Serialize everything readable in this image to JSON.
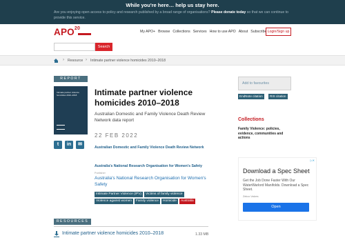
{
  "banner": {
    "title": "While you're here… help us stay here.",
    "text": "Are you enjoying open access to policy and research published by a broad range of organisations?",
    "donate": "Please donate today",
    "text_end": "so that we can continue to provide this service."
  },
  "header": {
    "logo": "APO",
    "logo_sup": "20",
    "nav": [
      "My APO+",
      "Browse",
      "Collections",
      "Services",
      "How to use APO",
      "About",
      "Subscribe"
    ],
    "login": "Login/Sign up",
    "search_button": "Search"
  },
  "breadcrumb": [
    "Resource",
    "Intimate partner violence homicides 2010–2018"
  ],
  "left": {
    "report_label": "REPORT",
    "cover_title": "Intimate partner violence homicides 2010–2018",
    "title": "Intimate partner violence homicides 2010–2018",
    "subtitle": "Australian Domestic and Family Violence Death Review Network data report",
    "date": "22 FEB 2022",
    "author1": "Australian Domestic and Family Violence Death Review Network",
    "author2": "Australia's National Research Organisation for Women's Safety",
    "publisher_label": "Publisher",
    "publisher": "Australia's National Research Organisation for Women's Safety",
    "tags_row1": [
      "Intimate Partner Violence (IPV)",
      "Victims of family violence"
    ],
    "tags_row2": [
      "Violence against women",
      "Family violence",
      "Homicide"
    ],
    "tag_red": "Australia",
    "resources_label": "RESOURCES",
    "resource_title": "Intimate partner violence homicides 2010–2018",
    "resource_size": "1.33 MB"
  },
  "share": {
    "twitter": "t",
    "linkedin": "in",
    "email": "✉"
  },
  "right": {
    "favourites": "Add to favourites",
    "citations": [
      "EndNote citation",
      "RIS citation"
    ],
    "collections_title": "Collections",
    "collection_item": "Family Violence: policies, evidence, communities and actions"
  },
  "ad": {
    "title": "Download a Spec Sheet",
    "text": "Get the Job Done Faster With Our WaterWarlord Manifolds. Download a Spec Sheet.",
    "brand": "Zekco Valves",
    "button": "Open"
  },
  "colors": {
    "brand_red": "#c4181f",
    "banner_bg": "#1f3f4d",
    "link_blue": "#1f5f8b"
  }
}
